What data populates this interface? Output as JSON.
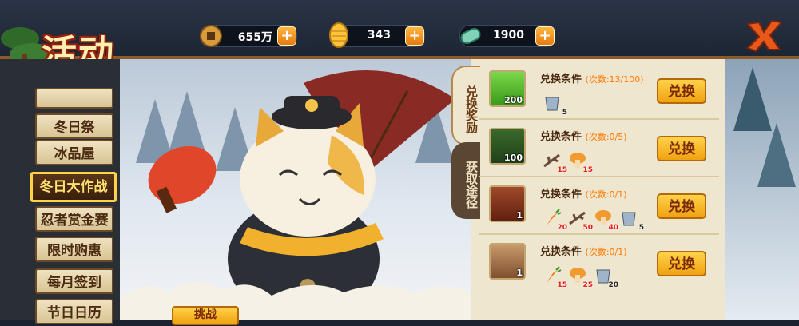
{
  "title": "活动",
  "currencies": [
    {
      "icon": "copper-coin-icon",
      "value": "655万"
    },
    {
      "icon": "gold-ingot-icon",
      "value": "343"
    },
    {
      "icon": "jade-icon",
      "value": "1900"
    }
  ],
  "sidebar": {
    "items": [
      {
        "label": "冬日祭",
        "active": false
      },
      {
        "label": "冰品屋",
        "active": false
      },
      {
        "label": "冬日大作战",
        "active": true
      },
      {
        "label": "忍者赏金赛",
        "active": false
      },
      {
        "label": "限时购惠",
        "active": false
      },
      {
        "label": "每月签到",
        "active": false
      },
      {
        "label": "节日日历",
        "active": false
      }
    ]
  },
  "tabs": [
    {
      "label": "兑换奖励",
      "active": true
    },
    {
      "label": "获取途径",
      "active": false
    }
  ],
  "exchange": [
    {
      "reward_icon": "paw-token-icon",
      "reward_count": "200",
      "condition_label": "兑换条件",
      "times": "(次数:13/100)",
      "button": "兑换",
      "materials": [
        {
          "icon": "ice-bucket-icon",
          "count": "5"
        }
      ]
    },
    {
      "reward_icon": "green-potion-icon",
      "reward_count": "100",
      "condition_label": "兑换条件",
      "times": "(次数:0/5)",
      "button": "兑换",
      "materials": [
        {
          "icon": "branch-icon",
          "count": "15"
        },
        {
          "icon": "mushroom-icon",
          "count": "15"
        }
      ]
    },
    {
      "reward_icon": "scroll-ticket-icon",
      "reward_count": "1",
      "condition_label": "兑换条件",
      "times": "(次数:0/1)",
      "button": "兑换",
      "materials": [
        {
          "icon": "carrot-icon",
          "count": "20"
        },
        {
          "icon": "branch-icon",
          "count": "50"
        },
        {
          "icon": "mushroom-icon",
          "count": "40"
        },
        {
          "icon": "ice-bucket-icon",
          "count": "5"
        }
      ]
    },
    {
      "reward_icon": "ninja-portrait-icon",
      "reward_count": "1",
      "condition_label": "兑换条件",
      "times": "(次数:0/1)",
      "button": "兑换",
      "materials": [
        {
          "icon": "carrot-icon",
          "count": "15"
        },
        {
          "icon": "mushroom-icon",
          "count": "25"
        },
        {
          "icon": "ice-bucket-icon",
          "count": "20"
        }
      ]
    }
  ],
  "bottom_button": "挑战",
  "colors": {
    "accent": "#ffd24a",
    "panel": "#efe6cf",
    "brown": "#6b3a12"
  }
}
